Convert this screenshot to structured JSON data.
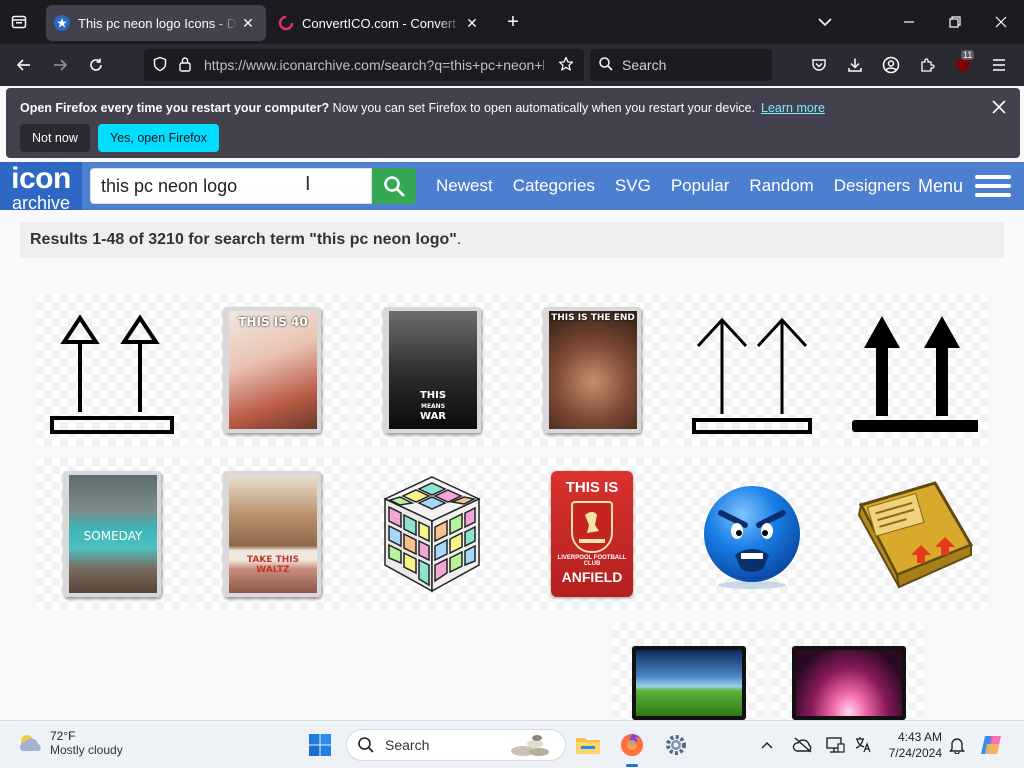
{
  "browser": {
    "tabs": [
      {
        "title": "This pc neon logo Icons - Download",
        "active": true,
        "icon": "star-icon"
      },
      {
        "title": "ConvertICO.com - Convert PNG",
        "active": false,
        "icon": "converticon-icon"
      }
    ],
    "url": "https://www.iconarchive.com/search?q=this+pc+neon+logo",
    "search_placeholder": "Search",
    "extension_badge": "11"
  },
  "notification": {
    "bold": "Open Firefox every time you restart your computer?",
    "text": " Now you can set Firefox to open automatically when you restart your device.",
    "learn_more": "Learn more",
    "not_now": "Not now",
    "yes_open": "Yes, open Firefox"
  },
  "site": {
    "logo_top": "icon",
    "logo_bottom": "archive",
    "search_value": "this pc neon logo",
    "nav": [
      "Newest",
      "Categories",
      "SVG",
      "Popular",
      "Random",
      "Designers"
    ],
    "menu": "Menu"
  },
  "results": {
    "prefix": "Results 1-48 of 3210 for search term \"this pc neon logo\"",
    "suffix": "."
  },
  "icons": {
    "this_is_40": "THIS IS 40",
    "this_means_war_1": "THIS",
    "this_means_war_2": "MEANS",
    "this_means_war_3": "WAR",
    "this_is_the_end": "THIS IS THE END",
    "someday": "SOMEDAY",
    "take_this_waltz": "TAKE THIS WALTZ",
    "this_is": "THIS IS",
    "anfield": "ANFIELD",
    "liverpool": "LIVERPOOL FOOTBALL CLUB"
  },
  "taskbar": {
    "temp": "72°F",
    "weather": "Mostly cloudy",
    "search": "Search",
    "time": "4:43 AM",
    "date": "7/24/2024"
  }
}
